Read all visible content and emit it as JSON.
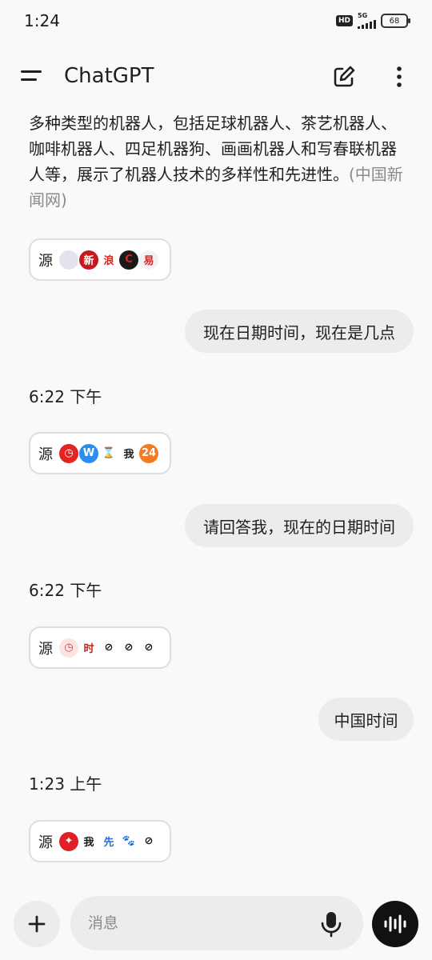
{
  "status_bar": {
    "time": "1:24",
    "hd": "HD",
    "network": "5G",
    "battery": "68"
  },
  "header": {
    "title": "ChatGPT",
    "menu_icon": "hamburger-menu-icon",
    "edit_icon": "new-chat-edit-icon",
    "more_icon": "more-vertical-icon"
  },
  "conversation": {
    "assistant_paragraph": "多种类型的机器人，包括足球机器人、茶艺机器人、咖啡机器人、四足机器狗、画画机器人和写春联机器人等，展示了机器人技术的多样性和先进性。",
    "citation": "(中国新闻网)",
    "source_label": "源",
    "sources": [
      {
        "icons": [
          {
            "name": "favicon-blank",
            "glyph": "",
            "bg": "#e6e2ec",
            "fg": "#e6e2ec"
          },
          {
            "name": "favicon-chinanews",
            "glyph": "新",
            "bg": "#c8161d",
            "fg": "#ffffff"
          },
          {
            "name": "favicon-sina",
            "glyph": "浪",
            "bg": "#ffffff",
            "fg": "#d7261d"
          },
          {
            "name": "favicon-c",
            "glyph": "C",
            "bg": "#1a1a1a",
            "fg": "#e02020"
          },
          {
            "name": "favicon-netease",
            "glyph": "易",
            "bg": "#f2f2f2",
            "fg": "#d0262b"
          }
        ]
      },
      {
        "icons": [
          {
            "name": "favicon-red-clock",
            "glyph": "◷",
            "bg": "#e52322",
            "fg": "#ffffff"
          },
          {
            "name": "favicon-w",
            "glyph": "W",
            "bg": "#2c8df0",
            "fg": "#ffffff"
          },
          {
            "name": "favicon-hourglass",
            "glyph": "⌛",
            "bg": "#ffffff",
            "fg": "#7a6a5a"
          },
          {
            "name": "favicon-wo",
            "glyph": "我",
            "bg": "#ffffff",
            "fg": "#1a1a1a"
          },
          {
            "name": "favicon-24",
            "glyph": "24",
            "bg": "#f47b20",
            "fg": "#ffffff"
          }
        ]
      },
      {
        "icons": [
          {
            "name": "favicon-clock",
            "glyph": "◷",
            "bg": "#fbe3e3",
            "fg": "#e23a3a"
          },
          {
            "name": "favicon-shi",
            "glyph": "时",
            "bg": "#ffffff",
            "fg": "#c81e1e"
          },
          {
            "name": "favicon-p1",
            "glyph": "⊘",
            "bg": "#ffffff",
            "fg": "#111111"
          },
          {
            "name": "favicon-p2",
            "glyph": "⊘",
            "bg": "#ffffff",
            "fg": "#111111"
          },
          {
            "name": "favicon-p3",
            "glyph": "⊘",
            "bg": "#ffffff",
            "fg": "#111111"
          }
        ]
      },
      {
        "icons": [
          {
            "name": "favicon-maple",
            "glyph": "✦",
            "bg": "#e01f26",
            "fg": "#ffffff"
          },
          {
            "name": "favicon-wo",
            "glyph": "我",
            "bg": "#ffffff",
            "fg": "#1a1a1a"
          },
          {
            "name": "favicon-xian",
            "glyph": "先",
            "bg": "#ffffff",
            "fg": "#2a6fd6"
          },
          {
            "name": "favicon-baidu",
            "glyph": "🐾",
            "bg": "#ffffff",
            "fg": "#2f5ee8"
          },
          {
            "name": "favicon-p4",
            "glyph": "⊘",
            "bg": "#ffffff",
            "fg": "#111111"
          }
        ]
      }
    ],
    "user_messages": [
      "现在日期时间，现在是几点",
      "请回答我，现在的日期时间",
      "中国时间"
    ],
    "replies": [
      "6:22 下午",
      "6:22 下午",
      "1:23 上午"
    ]
  },
  "composer": {
    "placeholder": "消息",
    "plus_icon": "plus-icon",
    "mic_icon": "microphone-icon",
    "voice_icon": "voice-mode-icon"
  }
}
